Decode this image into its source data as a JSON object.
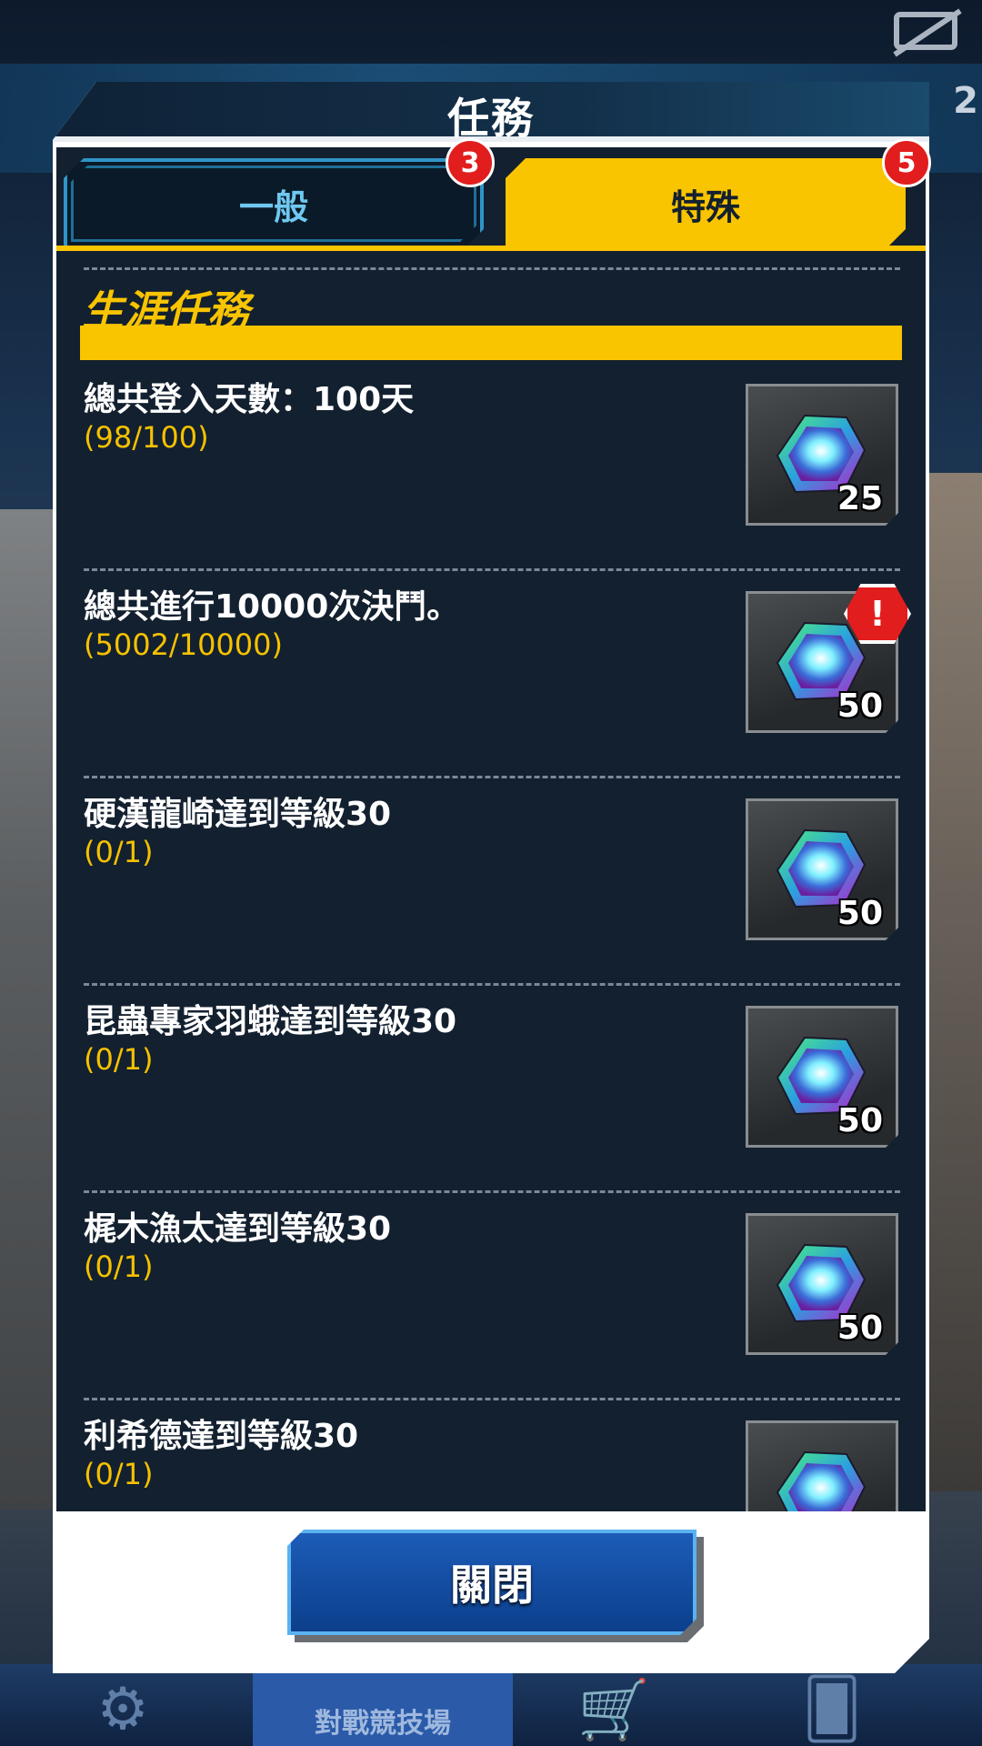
{
  "window": {
    "title": "任務"
  },
  "background": {
    "score_partial": "2",
    "nav_center_label": "對戰競技場"
  },
  "tabs": [
    {
      "label": "一般",
      "badge": "3",
      "active": false
    },
    {
      "label": "特殊",
      "badge": "5",
      "active": true
    }
  ],
  "section": {
    "title": "生涯任務"
  },
  "quests": [
    {
      "title": "總共登入天數：100天",
      "progress": "(98/100)",
      "reward_count": "25",
      "reward_icon": "gem-icon",
      "alert": false
    },
    {
      "title": "總共進行10000次決鬥。",
      "progress": "(5002/10000)",
      "reward_count": "50",
      "reward_icon": "gem-icon",
      "alert": true,
      "alert_text": "!"
    },
    {
      "title": "硬漢龍崎達到等級30",
      "progress": "(0/1)",
      "reward_count": "50",
      "reward_icon": "gem-icon",
      "alert": false
    },
    {
      "title": "昆蟲專家羽蛾達到等級30",
      "progress": "(0/1)",
      "reward_count": "50",
      "reward_icon": "gem-icon",
      "alert": false
    },
    {
      "title": "梶木漁太達到等級30",
      "progress": "(0/1)",
      "reward_count": "50",
      "reward_icon": "gem-icon",
      "alert": false
    },
    {
      "title": "利希德達到等級30",
      "progress": "(0/1)",
      "reward_count": "",
      "reward_icon": "gem-icon",
      "alert": false
    }
  ],
  "footer": {
    "close_label": "關閉"
  },
  "colors": {
    "accent": "#f9c400",
    "panel": "#13202f",
    "progress": "#f5c100",
    "badge": "#e21d1d",
    "close_button": "#0c3f8c"
  }
}
